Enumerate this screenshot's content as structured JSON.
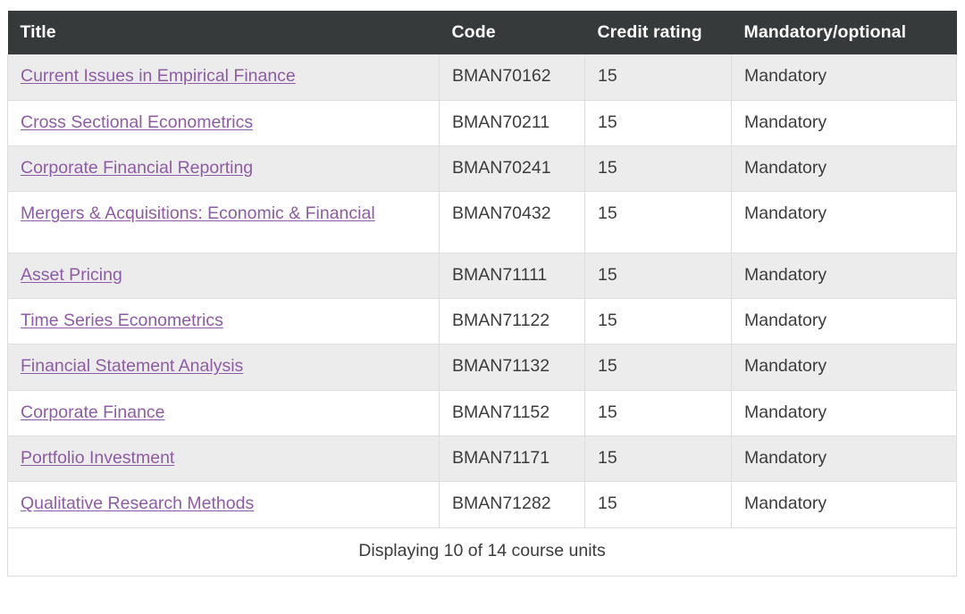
{
  "table": {
    "columns": [
      {
        "key": "title",
        "label": "Title"
      },
      {
        "key": "code",
        "label": "Code"
      },
      {
        "key": "credit",
        "label": "Credit rating"
      },
      {
        "key": "mandatory",
        "label": "Mandatory/optional"
      }
    ],
    "rows": [
      {
        "title": "Current Issues in Empirical Finance",
        "code": "BMAN70162",
        "credit": "15",
        "mandatory": "Mandatory"
      },
      {
        "title": "Cross Sectional Econometrics",
        "code": "BMAN70211",
        "credit": "15",
        "mandatory": "Mandatory"
      },
      {
        "title": "Corporate Financial Reporting",
        "code": "BMAN70241",
        "credit": "15",
        "mandatory": "Mandatory"
      },
      {
        "title": "Mergers & Acquisitions: Economic & Financial",
        "code": "BMAN70432",
        "credit": "15",
        "mandatory": "Mandatory"
      },
      {
        "title": "Asset Pricing",
        "code": "BMAN71111",
        "credit": "15",
        "mandatory": "Mandatory"
      },
      {
        "title": "Time Series Econometrics",
        "code": "BMAN71122",
        "credit": "15",
        "mandatory": "Mandatory"
      },
      {
        "title": "Financial Statement Analysis",
        "code": "BMAN71132",
        "credit": "15",
        "mandatory": "Mandatory"
      },
      {
        "title": "Corporate Finance",
        "code": "BMAN71152",
        "credit": "15",
        "mandatory": "Mandatory"
      },
      {
        "title": "Portfolio Investment",
        "code": "BMAN71171",
        "credit": "15",
        "mandatory": "Mandatory"
      },
      {
        "title": "Qualitative Research Methods",
        "code": "BMAN71282",
        "credit": "15",
        "mandatory": "Mandatory"
      }
    ],
    "footer": "Displaying 10 of 14 course units"
  },
  "colors": {
    "header_background": "#373a3a",
    "header_text": "#ffffff",
    "row_stripe": "#ececec",
    "row_plain": "#ffffff",
    "link": "#8e5ba6",
    "body_text": "#3c3c3c",
    "border": "#dedede"
  }
}
